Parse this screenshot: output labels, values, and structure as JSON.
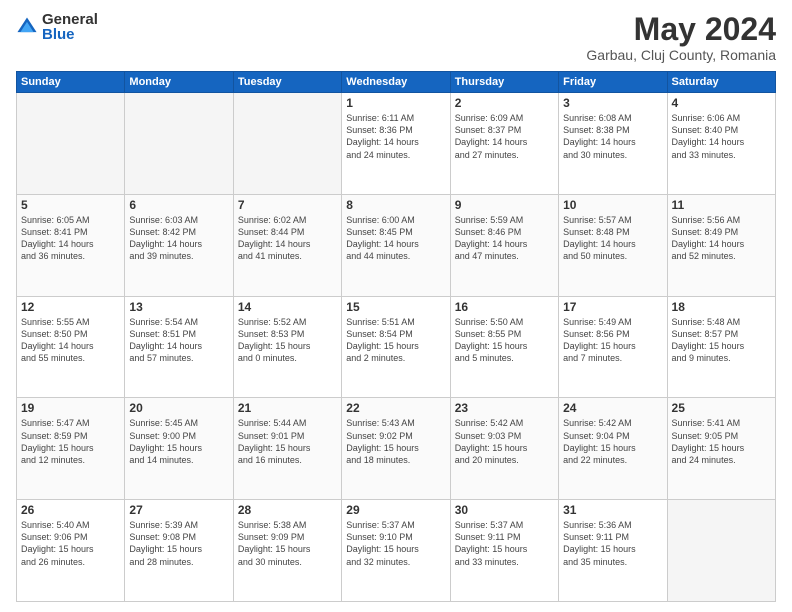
{
  "logo": {
    "general": "General",
    "blue": "Blue"
  },
  "header": {
    "month": "May 2024",
    "location": "Garbau, Cluj County, Romania"
  },
  "days_of_week": [
    "Sunday",
    "Monday",
    "Tuesday",
    "Wednesday",
    "Thursday",
    "Friday",
    "Saturday"
  ],
  "weeks": [
    [
      {
        "day": "",
        "info": ""
      },
      {
        "day": "",
        "info": ""
      },
      {
        "day": "",
        "info": ""
      },
      {
        "day": "1",
        "info": "Sunrise: 6:11 AM\nSunset: 8:36 PM\nDaylight: 14 hours\nand 24 minutes."
      },
      {
        "day": "2",
        "info": "Sunrise: 6:09 AM\nSunset: 8:37 PM\nDaylight: 14 hours\nand 27 minutes."
      },
      {
        "day": "3",
        "info": "Sunrise: 6:08 AM\nSunset: 8:38 PM\nDaylight: 14 hours\nand 30 minutes."
      },
      {
        "day": "4",
        "info": "Sunrise: 6:06 AM\nSunset: 8:40 PM\nDaylight: 14 hours\nand 33 minutes."
      }
    ],
    [
      {
        "day": "5",
        "info": "Sunrise: 6:05 AM\nSunset: 8:41 PM\nDaylight: 14 hours\nand 36 minutes."
      },
      {
        "day": "6",
        "info": "Sunrise: 6:03 AM\nSunset: 8:42 PM\nDaylight: 14 hours\nand 39 minutes."
      },
      {
        "day": "7",
        "info": "Sunrise: 6:02 AM\nSunset: 8:44 PM\nDaylight: 14 hours\nand 41 minutes."
      },
      {
        "day": "8",
        "info": "Sunrise: 6:00 AM\nSunset: 8:45 PM\nDaylight: 14 hours\nand 44 minutes."
      },
      {
        "day": "9",
        "info": "Sunrise: 5:59 AM\nSunset: 8:46 PM\nDaylight: 14 hours\nand 47 minutes."
      },
      {
        "day": "10",
        "info": "Sunrise: 5:57 AM\nSunset: 8:48 PM\nDaylight: 14 hours\nand 50 minutes."
      },
      {
        "day": "11",
        "info": "Sunrise: 5:56 AM\nSunset: 8:49 PM\nDaylight: 14 hours\nand 52 minutes."
      }
    ],
    [
      {
        "day": "12",
        "info": "Sunrise: 5:55 AM\nSunset: 8:50 PM\nDaylight: 14 hours\nand 55 minutes."
      },
      {
        "day": "13",
        "info": "Sunrise: 5:54 AM\nSunset: 8:51 PM\nDaylight: 14 hours\nand 57 minutes."
      },
      {
        "day": "14",
        "info": "Sunrise: 5:52 AM\nSunset: 8:53 PM\nDaylight: 15 hours\nand 0 minutes."
      },
      {
        "day": "15",
        "info": "Sunrise: 5:51 AM\nSunset: 8:54 PM\nDaylight: 15 hours\nand 2 minutes."
      },
      {
        "day": "16",
        "info": "Sunrise: 5:50 AM\nSunset: 8:55 PM\nDaylight: 15 hours\nand 5 minutes."
      },
      {
        "day": "17",
        "info": "Sunrise: 5:49 AM\nSunset: 8:56 PM\nDaylight: 15 hours\nand 7 minutes."
      },
      {
        "day": "18",
        "info": "Sunrise: 5:48 AM\nSunset: 8:57 PM\nDaylight: 15 hours\nand 9 minutes."
      }
    ],
    [
      {
        "day": "19",
        "info": "Sunrise: 5:47 AM\nSunset: 8:59 PM\nDaylight: 15 hours\nand 12 minutes."
      },
      {
        "day": "20",
        "info": "Sunrise: 5:45 AM\nSunset: 9:00 PM\nDaylight: 15 hours\nand 14 minutes."
      },
      {
        "day": "21",
        "info": "Sunrise: 5:44 AM\nSunset: 9:01 PM\nDaylight: 15 hours\nand 16 minutes."
      },
      {
        "day": "22",
        "info": "Sunrise: 5:43 AM\nSunset: 9:02 PM\nDaylight: 15 hours\nand 18 minutes."
      },
      {
        "day": "23",
        "info": "Sunrise: 5:42 AM\nSunset: 9:03 PM\nDaylight: 15 hours\nand 20 minutes."
      },
      {
        "day": "24",
        "info": "Sunrise: 5:42 AM\nSunset: 9:04 PM\nDaylight: 15 hours\nand 22 minutes."
      },
      {
        "day": "25",
        "info": "Sunrise: 5:41 AM\nSunset: 9:05 PM\nDaylight: 15 hours\nand 24 minutes."
      }
    ],
    [
      {
        "day": "26",
        "info": "Sunrise: 5:40 AM\nSunset: 9:06 PM\nDaylight: 15 hours\nand 26 minutes."
      },
      {
        "day": "27",
        "info": "Sunrise: 5:39 AM\nSunset: 9:08 PM\nDaylight: 15 hours\nand 28 minutes."
      },
      {
        "day": "28",
        "info": "Sunrise: 5:38 AM\nSunset: 9:09 PM\nDaylight: 15 hours\nand 30 minutes."
      },
      {
        "day": "29",
        "info": "Sunrise: 5:37 AM\nSunset: 9:10 PM\nDaylight: 15 hours\nand 32 minutes."
      },
      {
        "day": "30",
        "info": "Sunrise: 5:37 AM\nSunset: 9:11 PM\nDaylight: 15 hours\nand 33 minutes."
      },
      {
        "day": "31",
        "info": "Sunrise: 5:36 AM\nSunset: 9:11 PM\nDaylight: 15 hours\nand 35 minutes."
      },
      {
        "day": "",
        "info": ""
      }
    ]
  ]
}
